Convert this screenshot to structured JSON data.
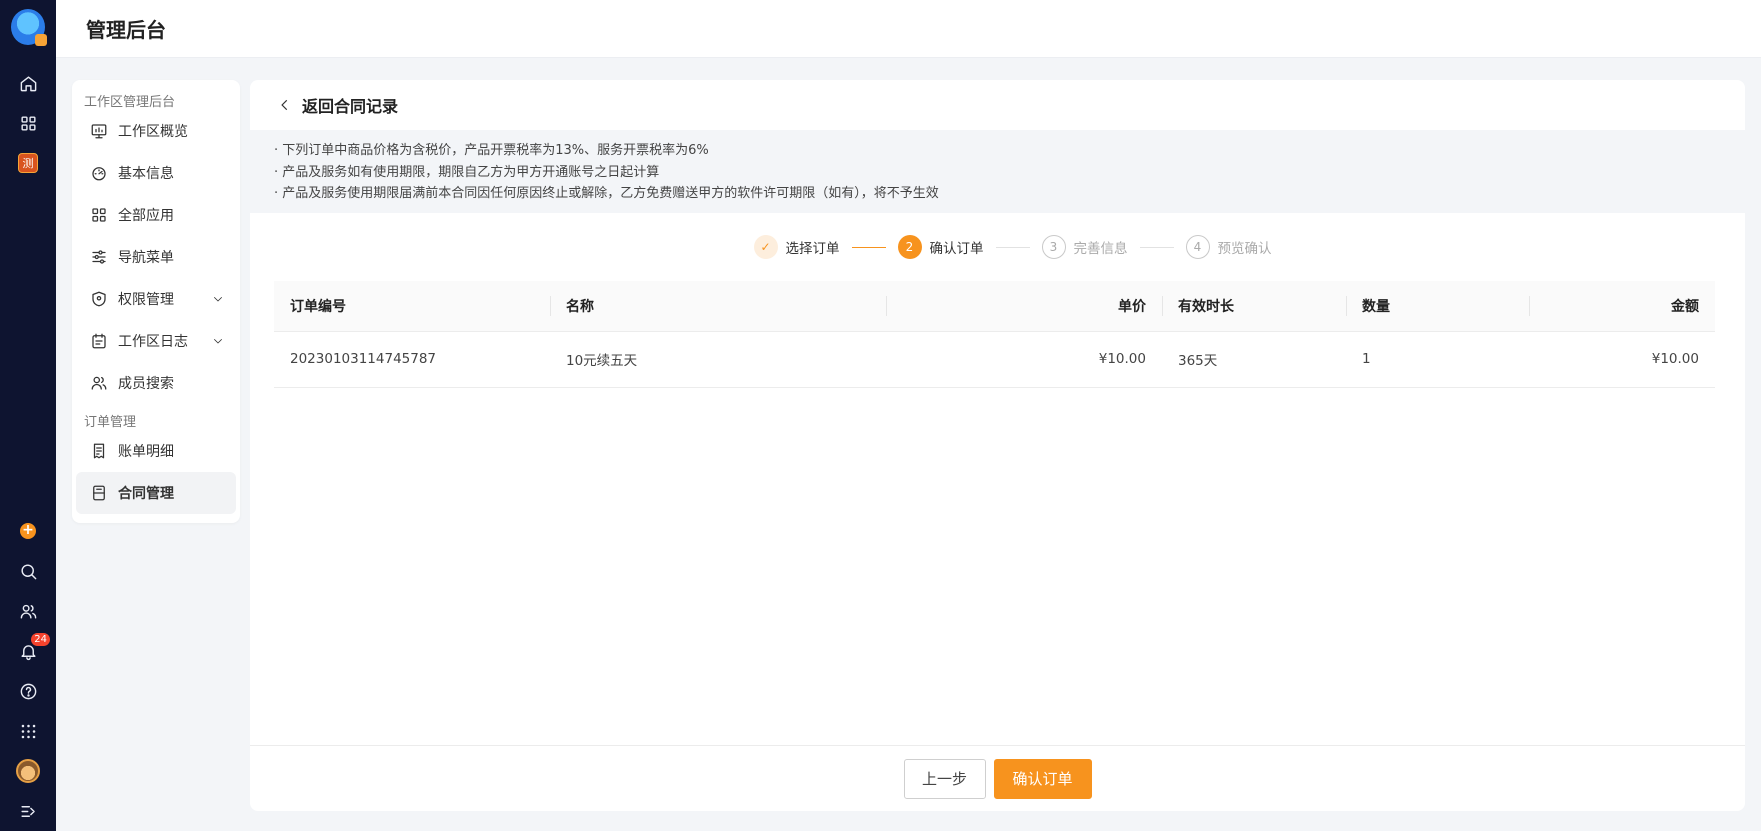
{
  "header": {
    "title": "管理后台"
  },
  "rail": {
    "workspace_badge": "测",
    "notification_count": "24",
    "plus_label": "+"
  },
  "sidebar": {
    "group1": "工作区管理后台",
    "items1": [
      {
        "label": "工作区概览",
        "icon": "monitor-chart-icon"
      },
      {
        "label": "基本信息",
        "icon": "gauge-icon"
      },
      {
        "label": "全部应用",
        "icon": "grid-icon"
      },
      {
        "label": "导航菜单",
        "icon": "sliders-icon"
      },
      {
        "label": "权限管理",
        "icon": "shield-icon"
      },
      {
        "label": "工作区日志",
        "icon": "calendar-icon"
      },
      {
        "label": "成员搜索",
        "icon": "users-icon"
      }
    ],
    "group2": "订单管理",
    "items2": [
      {
        "label": "账单明细",
        "icon": "receipt-icon"
      },
      {
        "label": "合同管理",
        "icon": "contract-icon"
      }
    ]
  },
  "main": {
    "back_label": "返回合同记录",
    "notices": [
      "· 下列订单中商品价格为含税价，产品开票税率为13%、服务开票税率为6%",
      "· 产品及服务如有使用期限，期限自乙方为甲方开通账号之日起计算",
      "· 产品及服务使用期限届满前本合同因任何原因终止或解除，乙方免费赠送甲方的软件许可期限（如有），将不予生效"
    ],
    "steps": [
      {
        "num": "✓",
        "label": "选择订单",
        "state": "done"
      },
      {
        "num": "2",
        "label": "确认订单",
        "state": "current"
      },
      {
        "num": "3",
        "label": "完善信息",
        "state": "todo"
      },
      {
        "num": "4",
        "label": "预览确认",
        "state": "todo"
      }
    ],
    "table": {
      "headers": [
        "订单编号",
        "名称",
        "单价",
        "有效时长",
        "数量",
        "金额"
      ],
      "rows": [
        [
          "20230103114745787",
          "10元续五天",
          "¥10.00",
          "365天",
          "1",
          "¥10.00"
        ]
      ]
    },
    "buttons": {
      "prev": "上一步",
      "confirm": "确认订单"
    }
  },
  "colors": {
    "accent": "#f7931e",
    "rail_bg": "#0e1430"
  }
}
